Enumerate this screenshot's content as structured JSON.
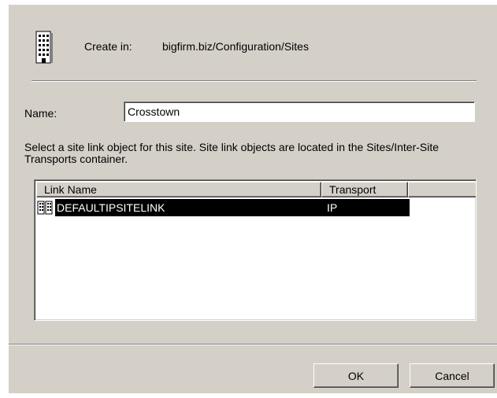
{
  "header": {
    "create_in_label": "Create in:",
    "create_in_path": "bigfirm.biz/Configuration/Sites",
    "icon": "building-icon"
  },
  "form": {
    "name_label": "Name:",
    "name_value": "Crosstown",
    "description": "Select a site link object for this site. Site link objects are located in the Sites/Inter-Site Transports container."
  },
  "site_links": {
    "columns": [
      "Link Name",
      "Transport"
    ],
    "rows": [
      {
        "link_name": "DEFAULTIPSITELINK",
        "transport": "IP",
        "selected": true,
        "icon": "site-link-icon"
      }
    ]
  },
  "buttons": {
    "ok_label": "OK",
    "cancel_label": "Cancel"
  },
  "colors": {
    "dialog_bg": "#d4d0c8",
    "selection_bg": "#000000",
    "selection_text": "#ffffff"
  }
}
